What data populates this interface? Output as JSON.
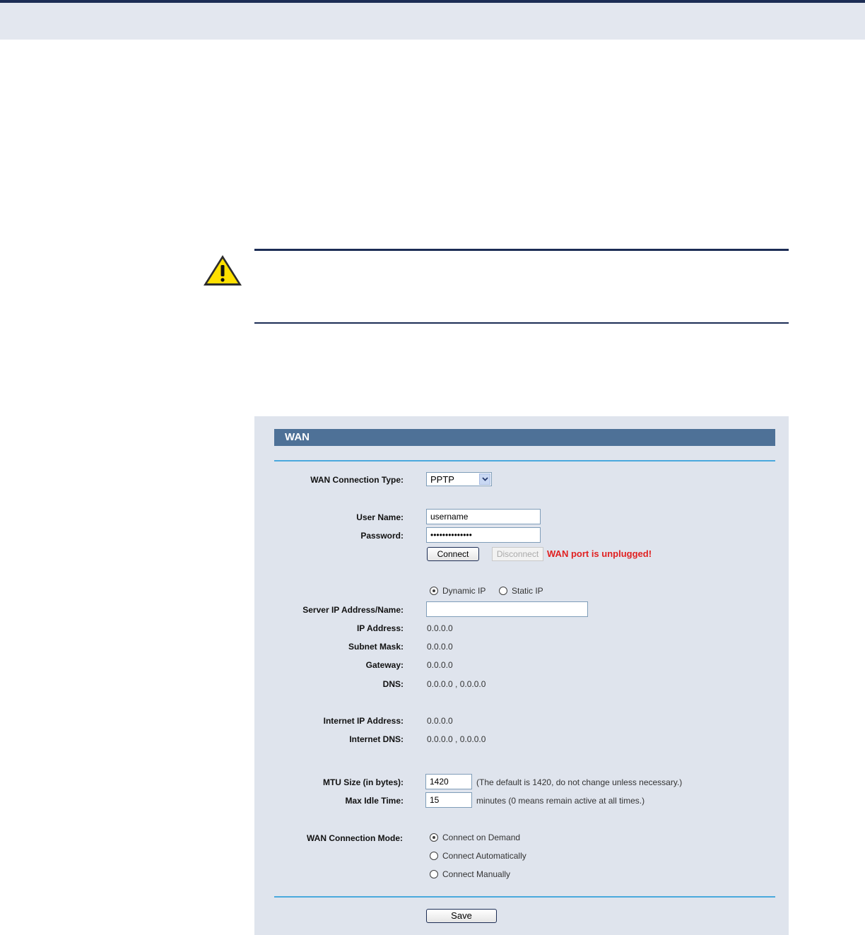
{
  "panel": {
    "title": "WAN",
    "connection_type": {
      "label": "WAN Connection Type:",
      "value": "PPTP"
    },
    "username": {
      "label": "User Name:",
      "value": "username"
    },
    "password": {
      "label": "Password:",
      "value": "••••••••••••••"
    },
    "connect_label": "Connect",
    "disconnect_label": "Disconnect",
    "status_message": "WAN port is unplugged!",
    "ip_mode": {
      "dynamic_label": "Dynamic IP",
      "static_label": "Static IP",
      "selected": "dynamic"
    },
    "server": {
      "label": "Server IP Address/Name:",
      "value": ""
    },
    "ip_address": {
      "label": "IP Address:",
      "value": "0.0.0.0"
    },
    "subnet_mask": {
      "label": "Subnet Mask:",
      "value": "0.0.0.0"
    },
    "gateway": {
      "label": "Gateway:",
      "value": "0.0.0.0"
    },
    "dns": {
      "label": "DNS:",
      "value": "0.0.0.0 , 0.0.0.0"
    },
    "internet_ip": {
      "label": "Internet IP Address:",
      "value": "0.0.0.0"
    },
    "internet_dns": {
      "label": "Internet DNS:",
      "value": "0.0.0.0 , 0.0.0.0"
    },
    "mtu": {
      "label": "MTU Size (in bytes):",
      "value": "1420",
      "hint": "(The default is 1420, do not change unless necessary.)"
    },
    "idle": {
      "label": "Max Idle Time:",
      "value": "15",
      "hint": "minutes (0 means remain active at all times.)"
    },
    "mode": {
      "label": "WAN Connection Mode:",
      "options": [
        "Connect on Demand",
        "Connect Automatically",
        "Connect Manually"
      ],
      "selected": "Connect on Demand"
    },
    "save_label": "Save"
  },
  "colors": {
    "title_bar": "#4e7197",
    "panel_bg": "#dfe4ed",
    "divider": "#4aa9dd",
    "warning": "#e12121",
    "rule": "#1c2d55"
  }
}
